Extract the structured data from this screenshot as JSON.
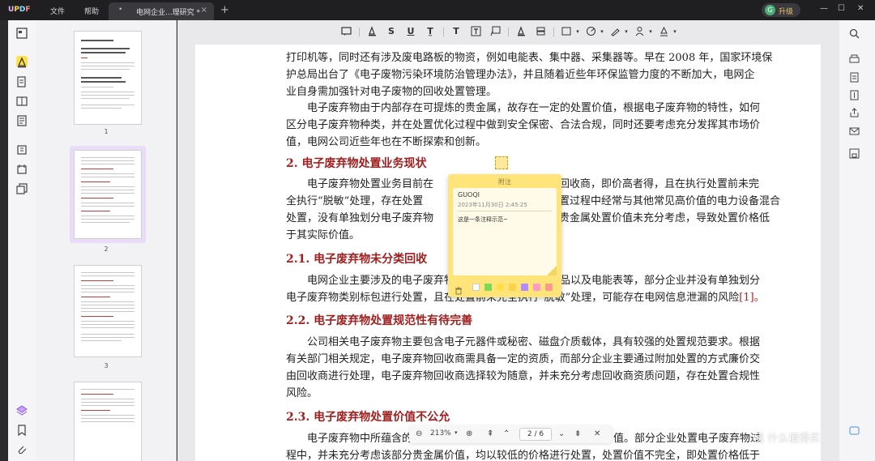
{
  "app": {
    "logo": "UPDF",
    "menu": [
      "文件",
      "帮助"
    ],
    "upgrade_label": "升级",
    "avatar_letter": "G"
  },
  "tab": {
    "title": "电网企业...理研究 *"
  },
  "thumbs": [
    {
      "num": "1"
    },
    {
      "num": "2"
    },
    {
      "num": "3"
    }
  ],
  "doc": {
    "lines_top": [
      "打印机等，同时还有涉及废电路板的物资，例如电能表、集中器、采集器等。早在 2008 年，国家环境保",
      "护总局出台了《电子废物污染环境防治管理办法》，并且随着近些年环保监管力度的不断加大，电网企",
      "业自身需加强针对电子废物的回收处置管理。",
      "　　电子废弃物由于内部存在可提炼的贵金属，故存在一定的处置价值，根据电子废弃物的特性，如何",
      "区分电子废弃物种类，并在处置优化过程中做到安全保密、合法合规，同时还要考虑充分发挥其市场价",
      "值，电网公司近些年也在不断探索和创新。"
    ],
    "h2_main": "2.  电子废弃物处置业务现状",
    "p2_left": [
      "　　电子废弃物处置业务目前在",
      "全执行“脱敏”处理，存在处置",
      "处置，没有单独划分电子废弃物",
      "于其实际价值。"
    ],
    "p2_right": [
      "认回收商，即价高者得，且在执行处置前未完",
      "处置过程中经常与其他常见高价值的电力设备混合",
      "内贵金属处置价值未充分考虑，导致处置价格低"
    ],
    "h21": "2.1.  电子废弃物未分类回收",
    "p21": [
      "　　电网企业主要涉及的电子废弃物包括电器产品、电子产品以及电能表等，部分企业并没有单独划分",
      "电子废弃物类别标包进行处置，且在处置前未完全执行“脱敏”处理，可能存在电网信息泄漏的风险"
    ],
    "cite1": "[1]。",
    "h22": "2.2.  电子废弃物处置规范性有待完善",
    "p22": [
      "　　公司相关电子废弃物主要包含电子元器件或秘密、磁盘介质载体，具有较强的处置规范要求。根据",
      "有关部门相关规定，电子废弃物回收商需具备一定的资质，而部分企业主要通过附加处置的方式廉价交",
      "由回收商进行处理，电子废弃物回收商选择较为随意，并未充分考虑回收商资质问题，存在处置合规性",
      "风险。"
    ],
    "h23": "2.3.  电子废弃物处置价值不公允",
    "p23_left": "　　电子废弃物中所蕴含的",
    "p23_right": "值。部分企业处置电子废弃物过",
    "p24": "程中，并未充分考虑该部分贵金属价值，均以较低的价格进行处置，处置价值不完全，即处置价格低于"
  },
  "note": {
    "header": "附注",
    "user": "GUOQI",
    "time": "2023年11月30日  2:45:25",
    "text": "这是一条注释示范~",
    "colors": [
      "#ffffff",
      "#7ed957",
      "#ffe04a",
      "#ffd24a",
      "#b08cff",
      "#ff9ec4",
      "#ff9a8a"
    ]
  },
  "nav": {
    "zoom": "213%",
    "page": "2 / 6"
  },
  "watermark": "值  什么值得买"
}
